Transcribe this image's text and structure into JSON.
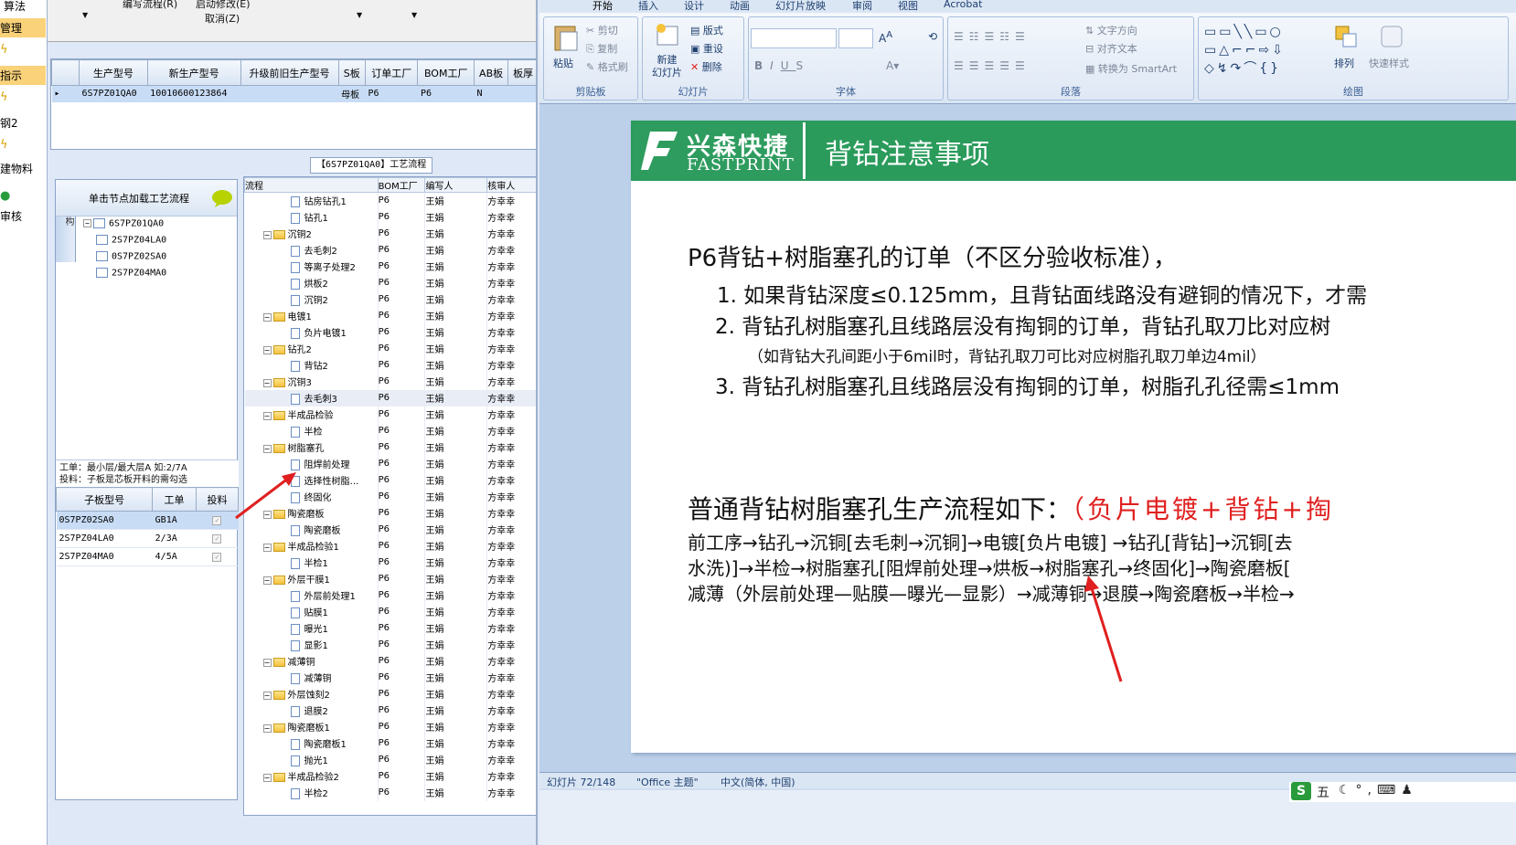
{
  "left_nav": {
    "items": [
      "算法",
      "管理",
      "指示",
      "钢2",
      "建物料",
      "审核"
    ]
  },
  "toolbar": {
    "edit_flow": "编写流程(R)",
    "start_modify": "启动修改(E)",
    "cancel": "取消(Z)"
  },
  "order_grid": {
    "columns": [
      "生产型号",
      "新生产型号",
      "升级前旧生产型号",
      "S板",
      "订单工厂",
      "BOM工厂",
      "AB板",
      "板厚"
    ],
    "rows": [
      [
        "6S7PZ01QA0",
        "10010600123864",
        "",
        "母板",
        "P6",
        "P6",
        "N",
        ""
      ]
    ]
  },
  "flow_panel_title": "【6S7PZ01QA0】工艺流程",
  "tree": {
    "side_tab": "设备结构",
    "header": "单击节点加载工艺流程",
    "root": "6S7PZ01QA0",
    "children": [
      "2S7PZ04LA0",
      "0S7PZ02SA0",
      "2S7PZ04MA0"
    ]
  },
  "hint": {
    "line1": "工单：最小层/最大层A 如:2/7A",
    "line2": "投料：子板是芯板开料的需勾选"
  },
  "sub_grid": {
    "columns": [
      "子板型号",
      "工单",
      "投料"
    ],
    "rows": [
      [
        "0S7PZ02SA0",
        "GB1A",
        ""
      ],
      [
        "2S7PZ04LA0",
        "2/3A",
        ""
      ],
      [
        "2S7PZ04MA0",
        "4/5A",
        ""
      ]
    ]
  },
  "flow_grid": {
    "columns": [
      "流程",
      "BOM工厂",
      "编写人",
      "核审人"
    ],
    "factory": "P6",
    "writer": "王娟",
    "reviewer": "方幸幸",
    "rows": [
      {
        "name": "钻房钻孔1",
        "type": "step"
      },
      {
        "name": "钻孔1",
        "type": "step"
      },
      {
        "name": "沉铜2",
        "type": "group"
      },
      {
        "name": "去毛刺2",
        "type": "step"
      },
      {
        "name": "等离子处理2",
        "type": "step"
      },
      {
        "name": "烘板2",
        "type": "step"
      },
      {
        "name": "沉铜2",
        "type": "step"
      },
      {
        "name": "电镀1",
        "type": "group"
      },
      {
        "name": "负片电镀1",
        "type": "step"
      },
      {
        "name": "钻孔2",
        "type": "group"
      },
      {
        "name": "背钻2",
        "type": "step"
      },
      {
        "name": "沉铜3",
        "type": "group"
      },
      {
        "name": "去毛刺3",
        "type": "step",
        "selected": true
      },
      {
        "name": "半成品检验",
        "type": "group"
      },
      {
        "name": "半检",
        "type": "step"
      },
      {
        "name": "树脂塞孔",
        "type": "group"
      },
      {
        "name": "阻焊前处理",
        "type": "step"
      },
      {
        "name": "选择性树脂…",
        "type": "step"
      },
      {
        "name": "终固化",
        "type": "step"
      },
      {
        "name": "陶瓷磨板",
        "type": "group"
      },
      {
        "name": "陶瓷磨板",
        "type": "step"
      },
      {
        "name": "半成品检验1",
        "type": "group"
      },
      {
        "name": "半检1",
        "type": "step"
      },
      {
        "name": "外层干膜1",
        "type": "group"
      },
      {
        "name": "外层前处理1",
        "type": "step"
      },
      {
        "name": "贴膜1",
        "type": "step"
      },
      {
        "name": "曝光1",
        "type": "step"
      },
      {
        "name": "显影1",
        "type": "step"
      },
      {
        "name": "减薄铜",
        "type": "group"
      },
      {
        "name": "减薄铜",
        "type": "step"
      },
      {
        "name": "外层蚀刻2",
        "type": "group"
      },
      {
        "name": "退膜2",
        "type": "step"
      },
      {
        "name": "陶瓷磨板1",
        "type": "group"
      },
      {
        "name": "陶瓷磨板1",
        "type": "step"
      },
      {
        "name": "抛光1",
        "type": "step"
      },
      {
        "name": "半成品检验2",
        "type": "group"
      },
      {
        "name": "半检2",
        "type": "step"
      }
    ]
  },
  "ppt": {
    "tabs": [
      "开始",
      "插入",
      "设计",
      "动画",
      "幻灯片放映",
      "审阅",
      "视图",
      "Acrobat"
    ],
    "ribbon": {
      "clipboard": {
        "paste": "粘贴",
        "cut": "剪切",
        "copy": "复制",
        "format": "格式刷",
        "label": "剪贴板"
      },
      "slides": {
        "new": "新建\n幻灯片",
        "layout": "版式",
        "reset": "重设",
        "delete": "删除",
        "label": "幻灯片"
      },
      "font": {
        "label": "字体"
      },
      "paragraph": {
        "text_dir": "文字方向",
        "align_text": "对齐文本",
        "smartart": "转换为 SmartArt",
        "label": "段落"
      },
      "drawing": {
        "arrange": "排列",
        "quick_styles": "快速样式",
        "label": "绘图"
      }
    },
    "slide": {
      "logo_cn": "兴森快捷",
      "logo_en": "FASTPRINT",
      "title": "背钻注意事项",
      "heading1": "P6背钻+树脂塞孔的订单（不区分验收标准），",
      "item1": "1. 如果背钻深度≤0.125mm，且背钻面线路没有避铜的情况下，才需",
      "item2": "2. 背钻孔树脂塞孔且线路层没有掏铜的订单，背钻孔取刀比对应树",
      "item2_note": "（如背钻大孔间距小于6mil时，背钻孔取刀可比对应树脂孔取刀单边4mil）",
      "item3": "3. 背钻孔树脂塞孔且线路层没有掏铜的订单，树脂孔孔径需≤1mm",
      "heading2": "普通背钻树脂塞孔生产流程如下：",
      "heading2_red": "（负片电镀+背钻+掏",
      "flow1": "前工序→钻孔→沉铜[去毛刺→沉铜]→电镀[负片电镀] →钻孔[背钻]→沉铜[去",
      "flow2": "水洗)]→半检→树脂塞孔[阻焊前处理→烘板→树脂塞孔→终固化]→陶瓷磨板[",
      "flow3": "减薄（外层前处理—贴膜—曝光—显影）→减薄铜→退膜→陶瓷磨板→半检→"
    },
    "status": {
      "slide_no": "幻灯片 72/148",
      "theme": "\"Office 主题\"",
      "lang": "中文(简体, 中国)"
    },
    "tray": "五"
  },
  "colors": {
    "banner_green": "#2a9b5b",
    "red_text": "#e02020",
    "arrow_red": "#e02020",
    "highlight": "#f9d27a"
  }
}
